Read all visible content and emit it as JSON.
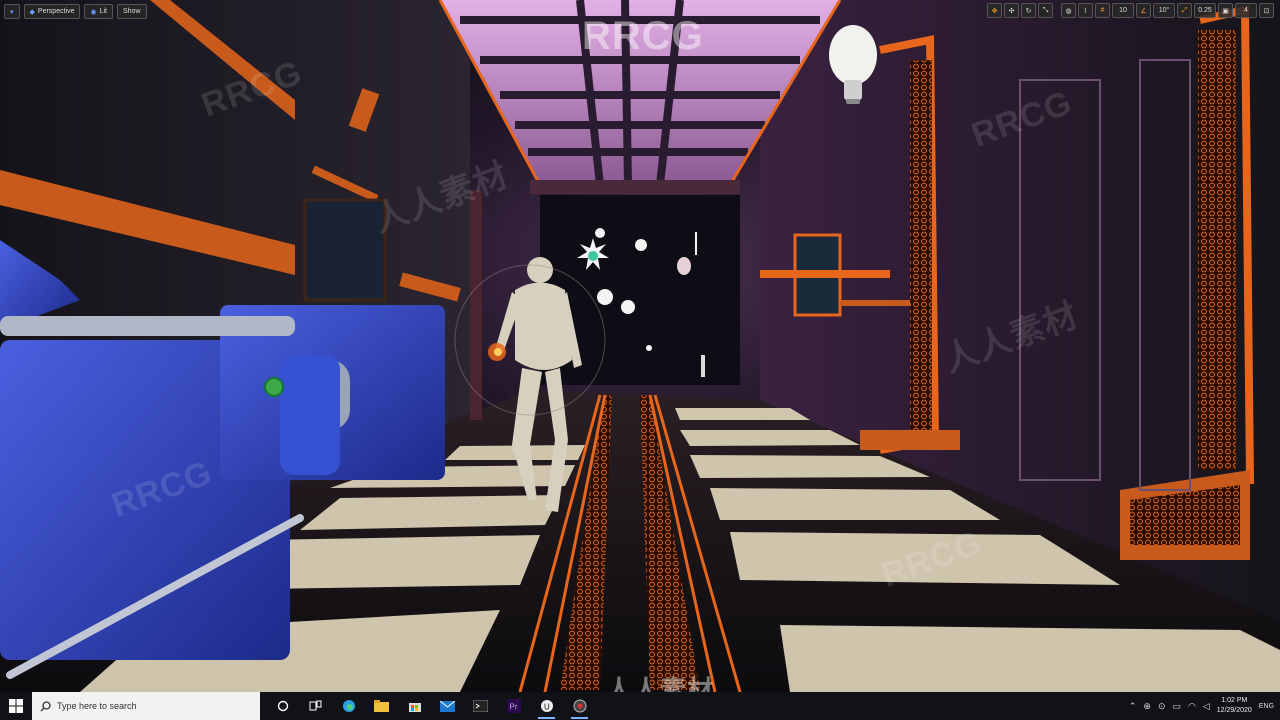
{
  "viewport": {
    "buttons": {
      "perspective": "Perspective",
      "lit": "Lit",
      "show": "Show"
    },
    "right_tools": {
      "grid_snap_value": "10",
      "rotation_snap_value": "10°",
      "scale_snap_value": "0.25",
      "camera_speed_value": "4"
    }
  },
  "watermarks": {
    "top": "RRCG",
    "bottom": "人人素材",
    "faint": "RRCG",
    "faint_cn": "人人素材"
  },
  "taskbar": {
    "search_placeholder": "Type here to search",
    "time": "1:02 PM",
    "date": "12/29/2020",
    "language": "ENG"
  },
  "colors": {
    "accent_orange": "#e8661c",
    "floor_tile": "#d9cfb5",
    "blue_machine": "#2d3fb0",
    "ceiling_pink": "#c48ad0"
  },
  "icons": {
    "windows": "windows-logo-icon",
    "search": "search-icon",
    "cortana": "cortana-icon",
    "task_view": "task-view-icon",
    "edge": "edge-icon",
    "explorer": "file-explorer-icon",
    "store": "store-icon",
    "mail": "mail-icon",
    "terminal": "terminal-icon",
    "premiere": "premiere-icon",
    "unreal": "unreal-engine-icon",
    "recorder": "recorder-icon"
  }
}
